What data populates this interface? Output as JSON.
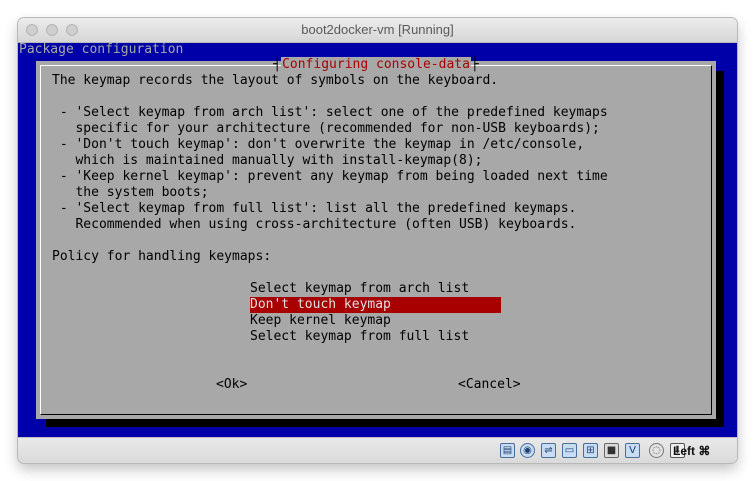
{
  "window": {
    "title": "boot2docker-vm [Running]"
  },
  "console": {
    "header": "Package configuration",
    "dialog_title": "Configuring console-data",
    "body_lines": [
      "The keymap records the layout of symbols on the keyboard.",
      "",
      " - 'Select keymap from arch list': select one of the predefined keymaps",
      "   specific for your architecture (recommended for non-USB keyboards);",
      " - 'Don't touch keymap': don't overwrite the keymap in /etc/console,",
      "   which is maintained manually with install-keymap(8);",
      " - 'Keep kernel keymap': prevent any keymap from being loaded next time",
      "   the system boots;",
      " - 'Select keymap from full list': list all the predefined keymaps.",
      "   Recommended when using cross-architecture (often USB) keyboards.",
      "",
      "Policy for handling keymaps:"
    ],
    "menu": [
      {
        "label": "Select keymap from arch list",
        "selected": false
      },
      {
        "label": "Don't touch keymap",
        "selected": true
      },
      {
        "label": "Keep kernel keymap",
        "selected": false
      },
      {
        "label": "Select keymap from full list",
        "selected": false
      }
    ],
    "ok_button": "<Ok>",
    "cancel_button": "<Cancel>"
  },
  "statusbar": {
    "icons": [
      "hard-disk-icon",
      "optical-drive-icon",
      "usb-icon",
      "shared-folders-icon",
      "network-icon",
      "video-capture-icon",
      "virtualbox-icon",
      "mouse-integration-icon",
      "keyboard-capture-icon"
    ],
    "host_key": "Left ⌘"
  }
}
